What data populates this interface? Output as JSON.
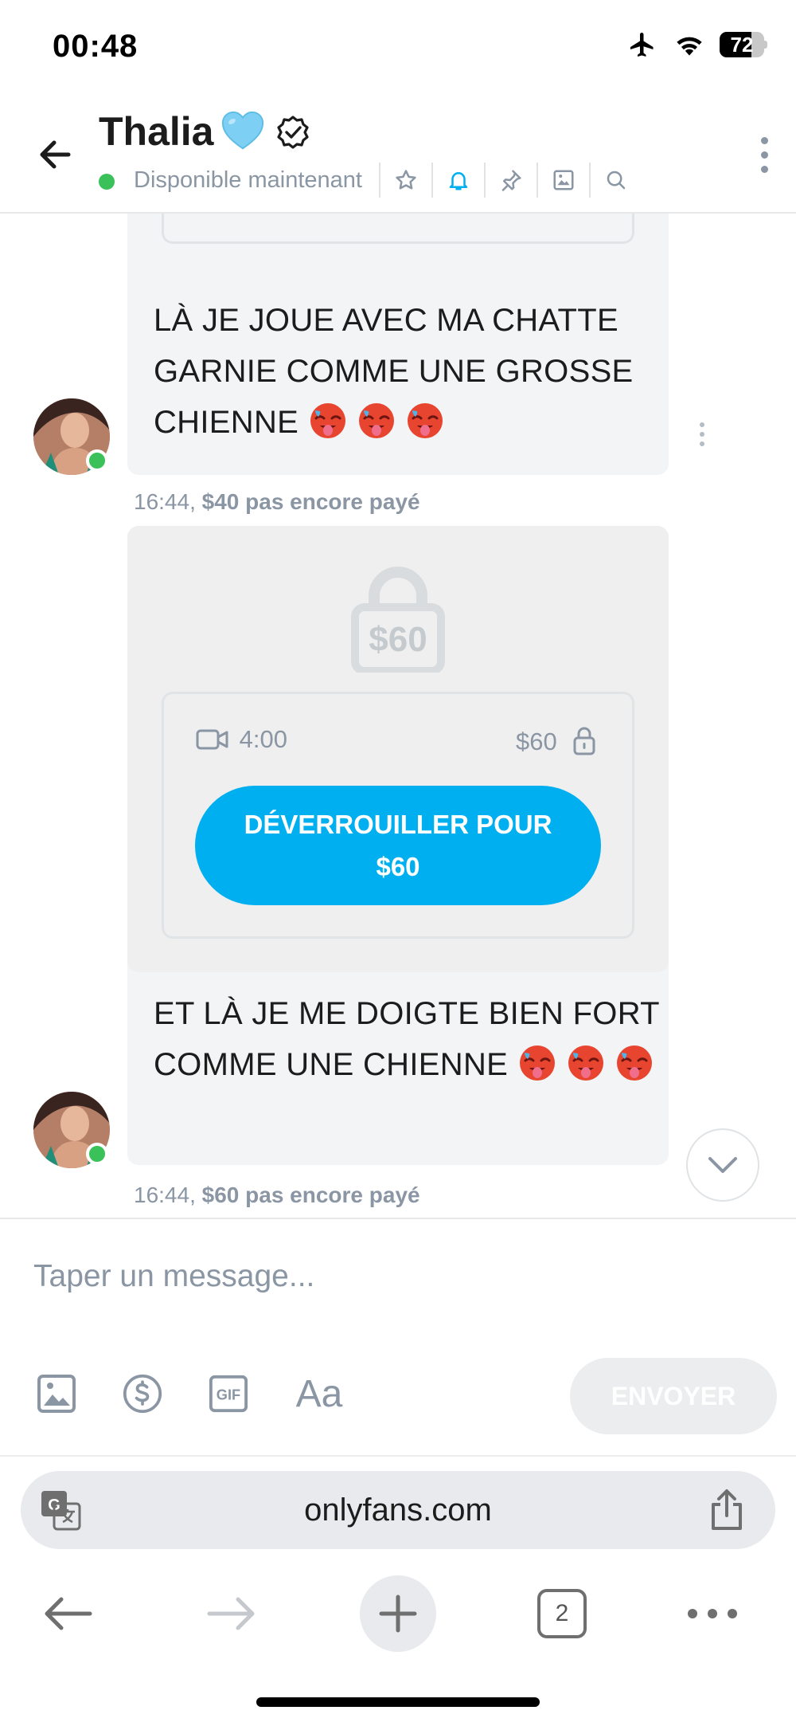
{
  "status_bar": {
    "time": "00:48",
    "battery_level": "72",
    "battery_fraction": 0.72,
    "icons": [
      "airplane-icon",
      "wifi-icon",
      "battery-icon"
    ]
  },
  "header": {
    "name": "Thalia",
    "name_emoji": "light-blue-heart",
    "status": "Disponible maintenant",
    "tools": [
      "star-icon",
      "bell-icon",
      "pin-icon",
      "image-icon",
      "search-icon"
    ],
    "colors": {
      "online": "#3ac159",
      "accent": "#00aff0",
      "muted": "#8a96a3"
    }
  },
  "messages": [
    {
      "text": "LÀ JE JOUE AVEC MA CHATTE GARNIE COMME UNE GROSSE CHIENNE",
      "emoji": "hot-face x3",
      "time": "16:44,",
      "price_status": "$40 pas encore payé"
    },
    {
      "locked_price": "$60",
      "media_duration": "4:00",
      "media_price": "$60",
      "unlock_label": "DÉVERROUILLER POUR",
      "unlock_price": "$60",
      "text": "ET LÀ JE ME DOIGTE BIEN FORT COMME UNE CHIENNE",
      "emoji": "hot-face x3",
      "time": "16:44,",
      "price_status": "$60 pas encore payé"
    }
  ],
  "composer": {
    "placeholder": "Taper un message...",
    "text_format": "Aa",
    "send_label": "ENVOYER",
    "tools": [
      "image-icon",
      "dollar-icon",
      "gif-icon",
      "text-format-icon"
    ]
  },
  "browser": {
    "url": "onlyfans.com",
    "tab_count": "2"
  }
}
